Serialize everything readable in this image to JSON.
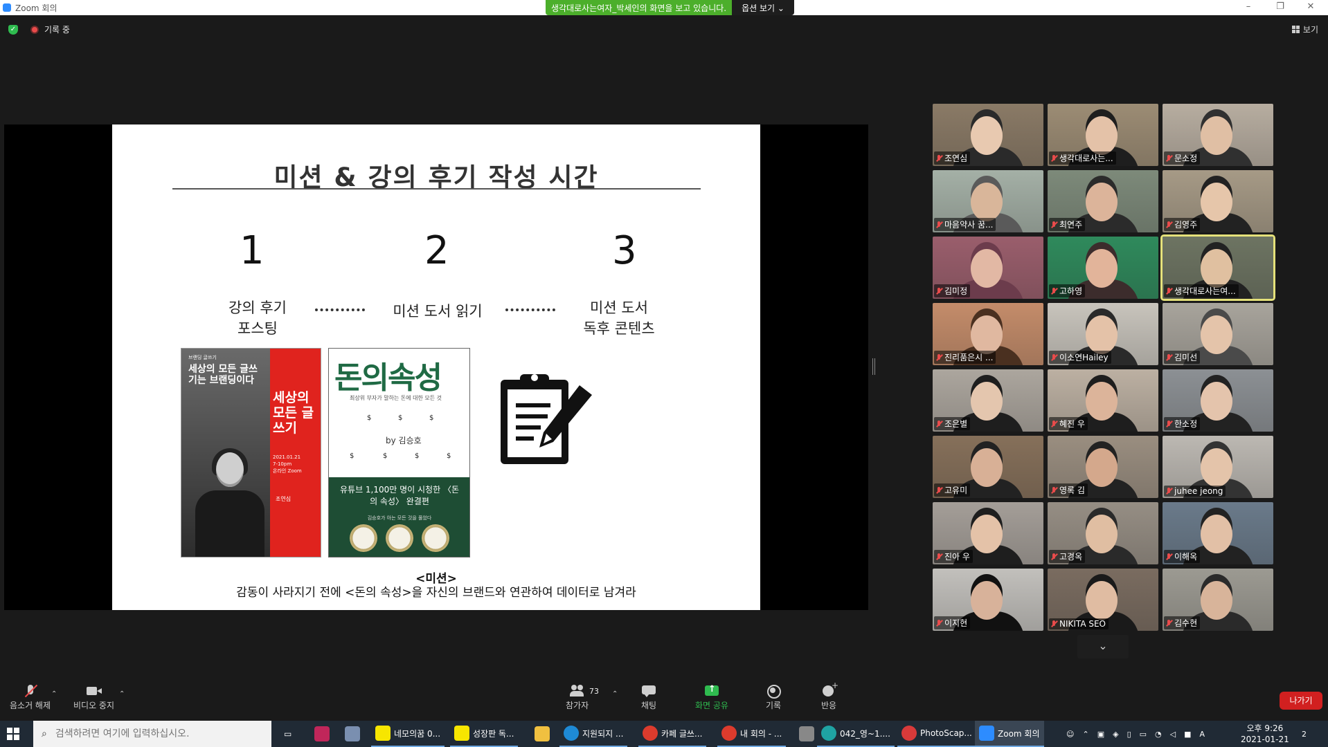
{
  "window": {
    "title": "Zoom 회의",
    "minimize": "–",
    "maximize": "❐",
    "close": "✕"
  },
  "banner": {
    "text": "생각대로사는여자_박세인의 화면을 보고 있습니다.",
    "options": "옵션 보기 ⌄"
  },
  "status": {
    "recording": "기록 중",
    "view": "보기"
  },
  "slide": {
    "title": "미션 & 강의 후기 작성 시간",
    "steps": [
      {
        "num": "1",
        "label": "강의 후기\n포스팅"
      },
      {
        "num": "2",
        "label": "미션 도서 읽기"
      },
      {
        "num": "3",
        "label": "미션 도서\n독후 콘텐츠"
      }
    ],
    "book1": {
      "small": "브랜딩 글쓰기",
      "headline": "세상의 모든 글쓰기는 브랜딩이다",
      "big": "세상의 모든 글쓰기",
      "date": "2021.01.21\n7-10pm\n온라인 Zoom",
      "author": "조연심"
    },
    "book2": {
      "title": "돈의속성",
      "subtitle": "최상위 부자가 말하는 돈에 대한 모든 것",
      "author": "by 김승호",
      "pitch": "유튜브 1,100만 명이 시청한 〈돈의 속성〉 완결편",
      "note": "김승호가 아는 모든 것을 풀었다"
    },
    "mission_heading": "<미션>",
    "mission_text": "감동이 사라지기 전에 <돈의 속성>을 자신의 브랜드와 연관하여 데이터로 남겨라"
  },
  "participants": [
    {
      "name": "조연심"
    },
    {
      "name": "생각대로사는..."
    },
    {
      "name": "문소정"
    },
    {
      "name": "마음약사 꿈..."
    },
    {
      "name": "최연주"
    },
    {
      "name": "김영주"
    },
    {
      "name": "김미정"
    },
    {
      "name": "고하영"
    },
    {
      "name": "생각대로사는여..."
    },
    {
      "name": "진리품은시 ..."
    },
    {
      "name": "이소연Hailey"
    },
    {
      "name": "김미선"
    },
    {
      "name": "조은별"
    },
    {
      "name": "혜진 우"
    },
    {
      "name": "한소정"
    },
    {
      "name": "고유미"
    },
    {
      "name": "영록 김"
    },
    {
      "name": "juhee jeong"
    },
    {
      "name": "진아 우"
    },
    {
      "name": "고경옥"
    },
    {
      "name": "이해옥"
    },
    {
      "name": "이지현"
    },
    {
      "name": "NIKITA SEO"
    },
    {
      "name": "김수현"
    }
  ],
  "toolbar": {
    "mute": "음소거 해제",
    "video": "비디오 중지",
    "participants": "참가자",
    "participant_count": "73",
    "chat": "채팅",
    "share": "화면 공유",
    "record": "기록",
    "reactions": "반응",
    "leave": "나가기"
  },
  "taskbar": {
    "search_placeholder": "검색하려면 여기에 입력하십시오.",
    "apps": [
      "네모의꿈 0...",
      "성장판 독...",
      "지원되지 ...",
      "카페 글쓰...",
      "내 회의 - ...",
      "042_영~1....",
      "PhotoScap...",
      "Zoom 회의"
    ],
    "time": "오후 9:26",
    "date": "2021-01-21",
    "ime": "A",
    "notif": "2"
  },
  "colors": {
    "accent": "#2d8cff",
    "share_green": "#2fbb4f",
    "leave_red": "#d12020",
    "book_green": "#1e4d34",
    "book_red": "#e0231e"
  }
}
